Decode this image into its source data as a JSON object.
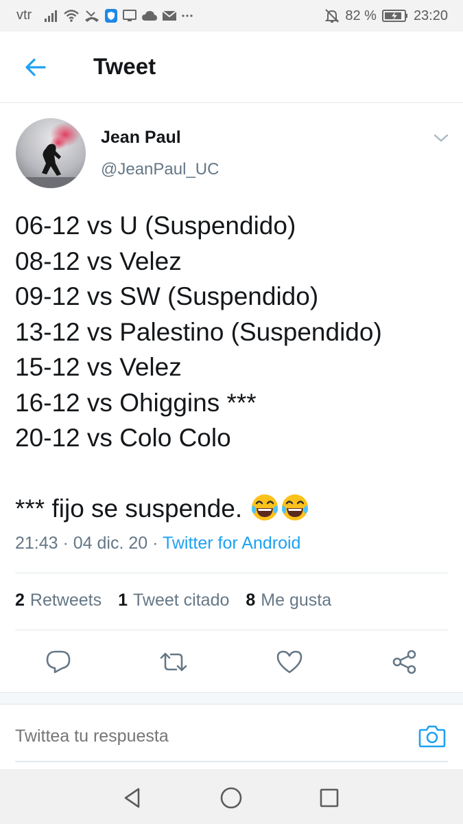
{
  "status_bar": {
    "carrier": "vtr",
    "battery": "82 %",
    "time": "23:20",
    "icons": [
      "signal-icon",
      "wifi-icon",
      "missed-call-icon",
      "shield-icon",
      "screen-icon",
      "cloud-icon",
      "mail-icon",
      "more-dots-icon",
      "mute-icon",
      "battery-icon"
    ]
  },
  "header": {
    "title": "Tweet"
  },
  "tweet": {
    "author_name": "Jean Paul",
    "author_handle": "@JeanPaul_UC",
    "lines": [
      "06-12 vs U (Suspendido)",
      "08-12 vs Velez",
      "09-12 vs SW (Suspendido)",
      "13-12 vs Palestino (Suspendido)",
      "15-12 vs Velez",
      "16-12 vs Ohiggins ***",
      "20-12 vs Colo Colo"
    ],
    "footnote": "*** fijo se suspende.",
    "emoji": "face-with-tears-of-joy",
    "meta_time": "21:43 · 04 dic. 20 · ",
    "source": "Twitter for Android"
  },
  "stats": {
    "retweets_count": "2",
    "retweets_label": "Retweets",
    "quotes_count": "1",
    "quotes_label": "Tweet citado",
    "likes_count": "8",
    "likes_label": "Me gusta"
  },
  "reply": {
    "placeholder": "Twittea tu respuesta"
  },
  "colors": {
    "accent": "#1da1f2",
    "text": "#14171a",
    "muted": "#657786",
    "border": "#e1e8ed"
  }
}
